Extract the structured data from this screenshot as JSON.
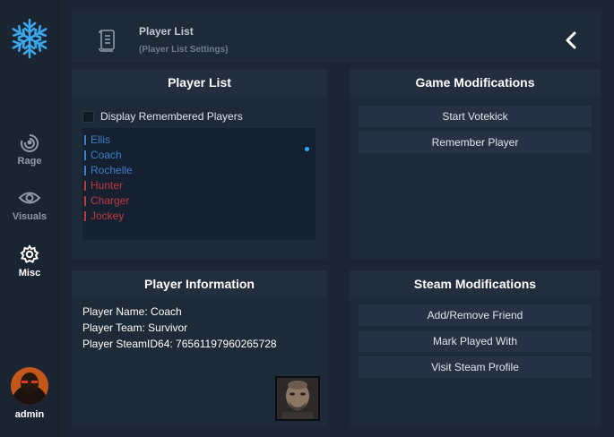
{
  "colors": {
    "accent": "#22aaff",
    "survivor": "#3d7fc9",
    "infected": "#c0393f"
  },
  "sidebar": {
    "logo": "snowflake-icon",
    "items": [
      {
        "label": "Rage",
        "icon": "target-icon",
        "active": false
      },
      {
        "label": "Visuals",
        "icon": "eye-icon",
        "active": false
      },
      {
        "label": "Misc",
        "icon": "gear-icon",
        "active": true
      }
    ],
    "user": {
      "name": "admin"
    }
  },
  "header": {
    "title": "Player List",
    "subtitle": "(Player List Settings)",
    "icon": "scroll-icon",
    "back_icon": "chevron-left-icon"
  },
  "player_list": {
    "title": "Player List",
    "checkbox_label": "Display Remembered Players",
    "players": [
      {
        "name": "Ellis",
        "team": "survivor"
      },
      {
        "name": "Coach",
        "team": "survivor"
      },
      {
        "name": "Rochelle",
        "team": "survivor"
      },
      {
        "name": "Hunter",
        "team": "infected"
      },
      {
        "name": "Charger",
        "team": "infected"
      },
      {
        "name": "Jockey",
        "team": "infected"
      }
    ]
  },
  "game_mods": {
    "title": "Game Modifications",
    "buttons": [
      "Start Votekick",
      "Remember Player"
    ]
  },
  "player_info": {
    "title": "Player Information",
    "name_line": "Player Name: Coach",
    "team_line": "Player Team: Survivor",
    "steam_line": "Player SteamID64: 76561197960265728"
  },
  "steam_mods": {
    "title": "Steam Modifications",
    "buttons": [
      "Add/Remove Friend",
      "Mark Played With",
      "Visit Steam Profile"
    ]
  }
}
